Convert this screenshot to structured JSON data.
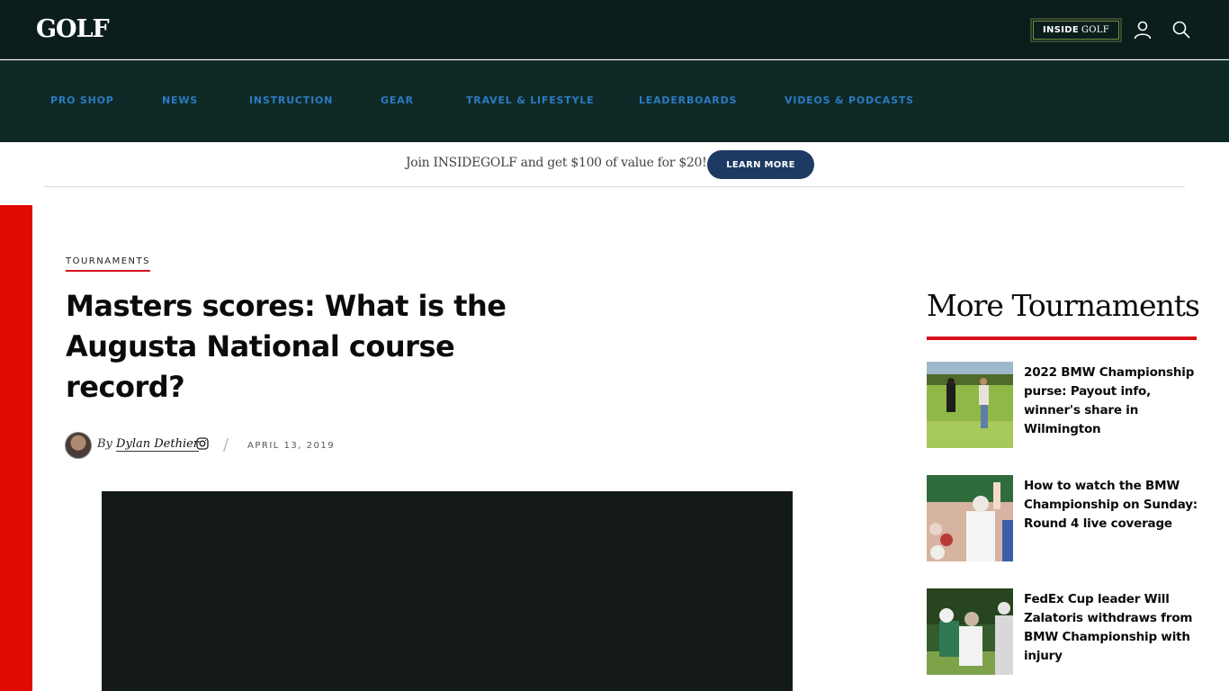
{
  "header": {
    "logo": "GOLF",
    "inside_golf_bold": "INSIDE",
    "inside_golf_thin": "GOLF"
  },
  "nav": {
    "items": [
      {
        "label": "PRO SHOP"
      },
      {
        "label": "NEWS"
      },
      {
        "label": "INSTRUCTION"
      },
      {
        "label": "GEAR"
      },
      {
        "label": "TRAVEL & LIFESTYLE"
      },
      {
        "label": "LEADERBOARDS"
      },
      {
        "label": "VIDEOS & PODCASTS"
      }
    ]
  },
  "promo": {
    "text": "Join INSIDEGOLF and get $100 of value for $20!",
    "button_label": "LEARN MORE"
  },
  "article": {
    "category": "TOURNAMENTS",
    "headline_lines": [
      "Masters scores: What is the",
      "Augusta National course",
      "record?"
    ],
    "by_prefix": "By",
    "author": "Dylan Dethier",
    "date": "APRIL 13, 2019"
  },
  "sidebar": {
    "title": "More Tournaments",
    "stories": [
      {
        "title": "2022 BMW Championship purse: Payout info, winner's share in Wilmington"
      },
      {
        "title": "How to watch the BMW Championship on Sunday: Round 4 live coverage"
      },
      {
        "title": "FedEx Cup leader Will Zalatoris withdraws from BMW Championship with injury"
      }
    ]
  },
  "colors": {
    "header_bg": "#0b1e1c",
    "nav_bg": "#0f2926",
    "nav_link": "#2b7bc2",
    "accent_red": "#d6121c",
    "button_navy": "#1d3a62"
  },
  "icons": {
    "account": "user-icon",
    "search": "search-icon",
    "social": "instagram-icon"
  }
}
